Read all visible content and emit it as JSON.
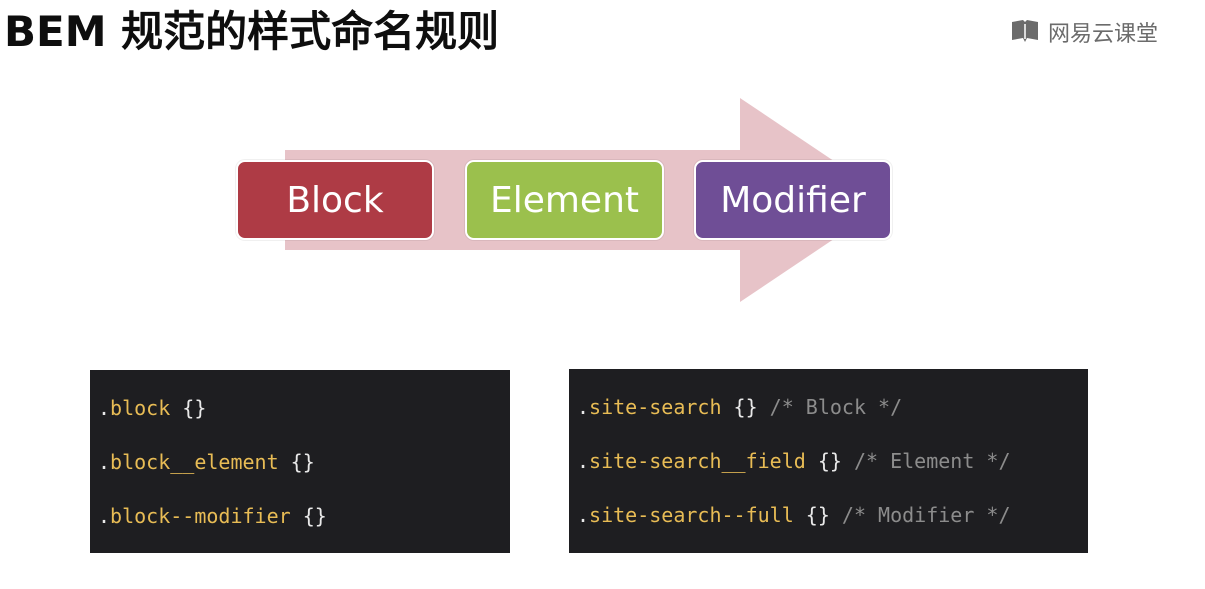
{
  "title": "BEM 规范的样式命名规则",
  "brand": {
    "name": "网易云课堂",
    "icon": "book-icon"
  },
  "diagram": {
    "arrow_color": "#e7c3c8",
    "boxes": [
      {
        "label": "Block",
        "color": "#ae3b45"
      },
      {
        "label": "Element",
        "color": "#9bc04d"
      },
      {
        "label": "Modifier",
        "color": "#6f4e96"
      }
    ]
  },
  "code_left": [
    {
      "dot": ".",
      "selector": "block",
      "rest": " {}"
    },
    {
      "dot": ".",
      "selector": "block__element",
      "rest": " {}"
    },
    {
      "dot": ".",
      "selector": "block--modifier",
      "rest": " {}"
    }
  ],
  "code_right": [
    {
      "dot": ".",
      "selector": "site-search",
      "rest": " {} ",
      "comment": "/* Block */"
    },
    {
      "dot": ".",
      "selector": "site-search__field",
      "rest": " {} ",
      "comment": "/* Element */"
    },
    {
      "dot": ".",
      "selector": "site-search--full",
      "rest": " {} ",
      "comment": "/* Modifier */"
    }
  ]
}
